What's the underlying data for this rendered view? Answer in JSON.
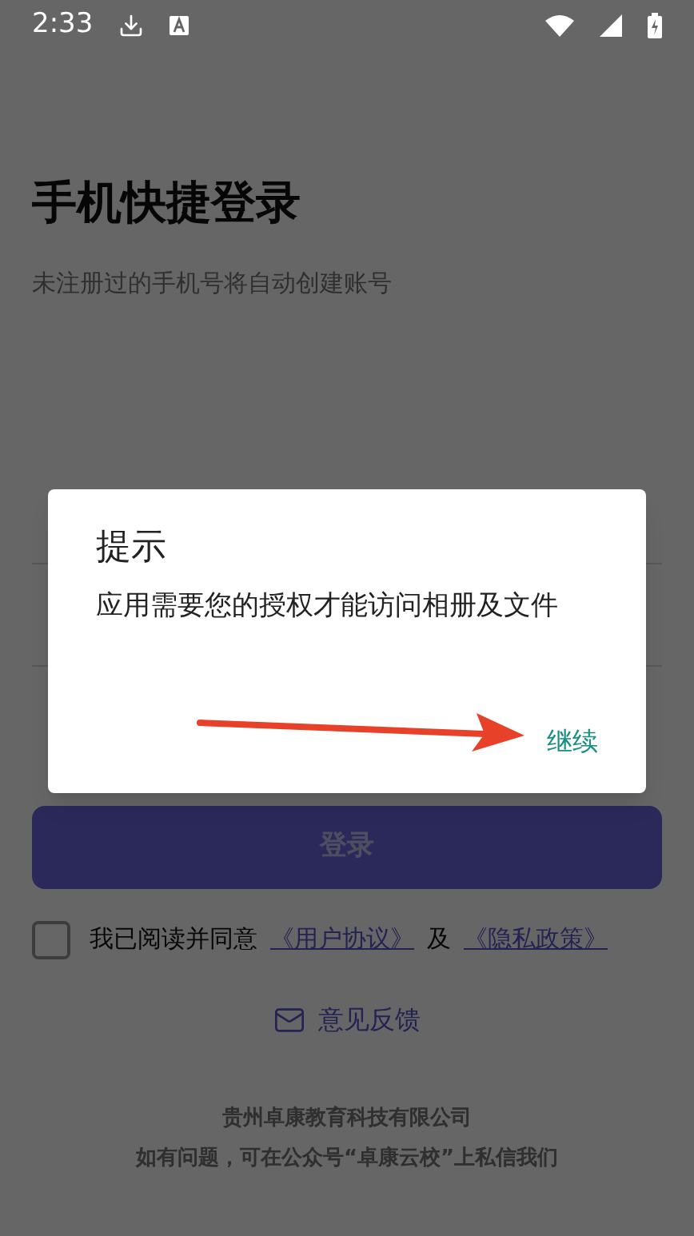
{
  "status_bar": {
    "time": "2:33"
  },
  "page": {
    "title": "手机快捷登录",
    "subtitle": "未注册过的手机号将自动创建账号"
  },
  "login_button": {
    "label": "登录"
  },
  "agreement": {
    "checked": false,
    "text": "我已阅读并同意",
    "link_1": "《用户协议》",
    "joiner": "及",
    "link_2": "《隐私政策》"
  },
  "feedback": {
    "label": "意见反馈"
  },
  "footer": {
    "company": "贵州卓康教育科技有限公司",
    "contact": "如有问题，可在公众号“卓康云校”上私信我们"
  },
  "dialog": {
    "title": "提示",
    "message": "应用需要您的授权才能访问相册及文件",
    "action": "继续"
  }
}
